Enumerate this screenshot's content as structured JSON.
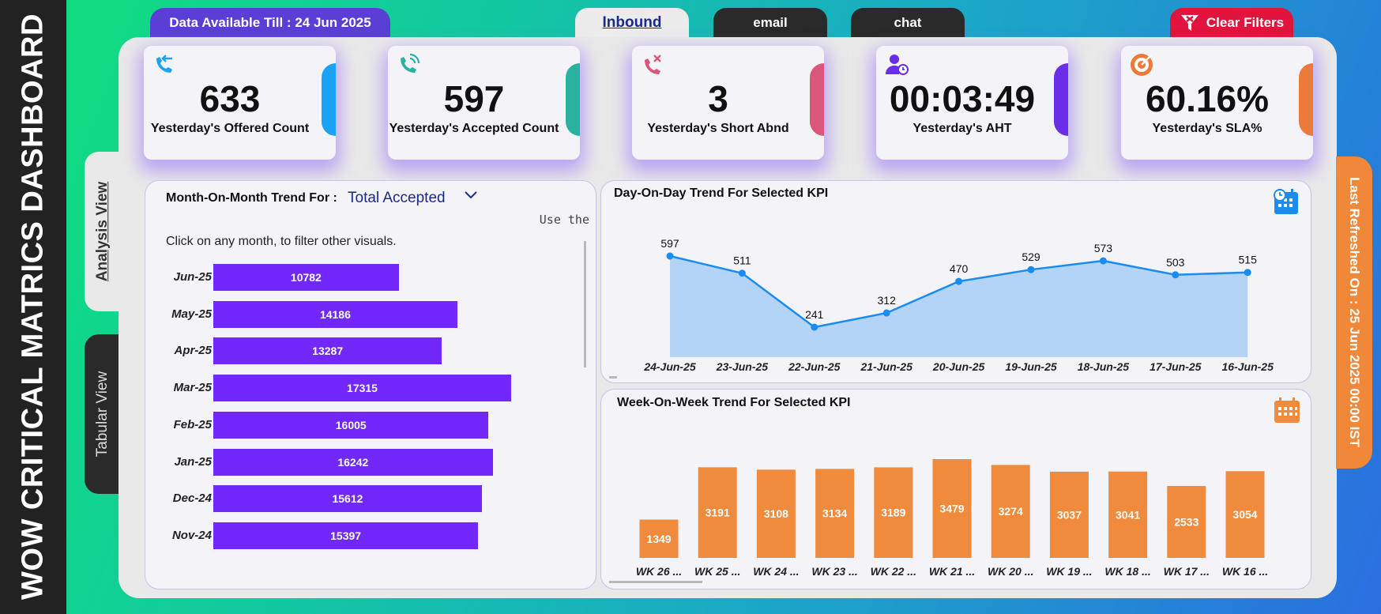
{
  "side_title": "WOW CRITICAL MATRICS DASHBOARD",
  "top_bar": {
    "data_till": "Data Available Till : 24 Jun 2025",
    "tabs": [
      "Inbound",
      "email",
      "chat"
    ],
    "clear_filters": "Clear Filters"
  },
  "side_tabs": {
    "analysis": "Analysis View",
    "tabular": "Tabular View"
  },
  "last_refreshed": "Last Refreshed On : 25 Jun 2025 00:00 IST",
  "kpis": [
    {
      "value": "633",
      "label": "Yesterday's Offered Count",
      "icon": "phone-incoming-icon",
      "accent": "#1aa3f5"
    },
    {
      "value": "597",
      "label": "Yesterday's Accepted Count",
      "icon": "phone-call-icon",
      "accent": "#28b3a0"
    },
    {
      "value": "3",
      "label": "Yesterday's Short Abnd",
      "icon": "phone-missed-icon",
      "accent": "#d9577a"
    },
    {
      "value": "00:03:49",
      "label": "Yesterday's AHT",
      "icon": "user-clock-icon",
      "accent": "#6a2de8"
    },
    {
      "value": "60.16%",
      "label": "Yesterday's SLA%",
      "icon": "target-icon",
      "accent": "#ec7a3a"
    }
  ],
  "mom": {
    "title": "Month-On-Month Trend For :",
    "selected_kpi": "Total Accepted",
    "note": "Use the",
    "hint": "Click on any month, to filter other visuals."
  },
  "dod_title": "Day-On-Day Trend For Selected KPI",
  "wow_title": "Week-On-Week Trend For Selected KPI",
  "chart_data": [
    {
      "type": "bar",
      "orientation": "horizontal",
      "title": "Month-On-Month Trend For : Total Accepted",
      "categories": [
        "Jun-25",
        "May-25",
        "Apr-25",
        "Mar-25",
        "Feb-25",
        "Jan-25",
        "Dec-24",
        "Nov-24"
      ],
      "values": [
        10782,
        14186,
        13287,
        17315,
        16005,
        16242,
        15612,
        15397
      ],
      "color": "#7228fa"
    },
    {
      "type": "area",
      "title": "Day-On-Day Trend For Selected KPI",
      "categories": [
        "24-Jun-25",
        "23-Jun-25",
        "22-Jun-25",
        "21-Jun-25",
        "20-Jun-25",
        "19-Jun-25",
        "18-Jun-25",
        "17-Jun-25",
        "16-Jun-25"
      ],
      "values": [
        597,
        511,
        241,
        312,
        470,
        529,
        573,
        503,
        515
      ],
      "color": "#1a8cf0",
      "fill": "#b3d3f7"
    },
    {
      "type": "bar",
      "title": "Week-On-Week Trend For Selected KPI",
      "categories": [
        "WK 26 ...",
        "WK 25 ...",
        "WK 24 ...",
        "WK 23 ...",
        "WK 22 ...",
        "WK 21 ...",
        "WK 20 ...",
        "WK 19 ...",
        "WK 18 ...",
        "WK 17 ...",
        "WK 16 ..."
      ],
      "values": [
        1349,
        3191,
        3108,
        3134,
        3189,
        3479,
        3274,
        3037,
        3041,
        2533,
        3054
      ],
      "color": "#f08a3c"
    }
  ]
}
